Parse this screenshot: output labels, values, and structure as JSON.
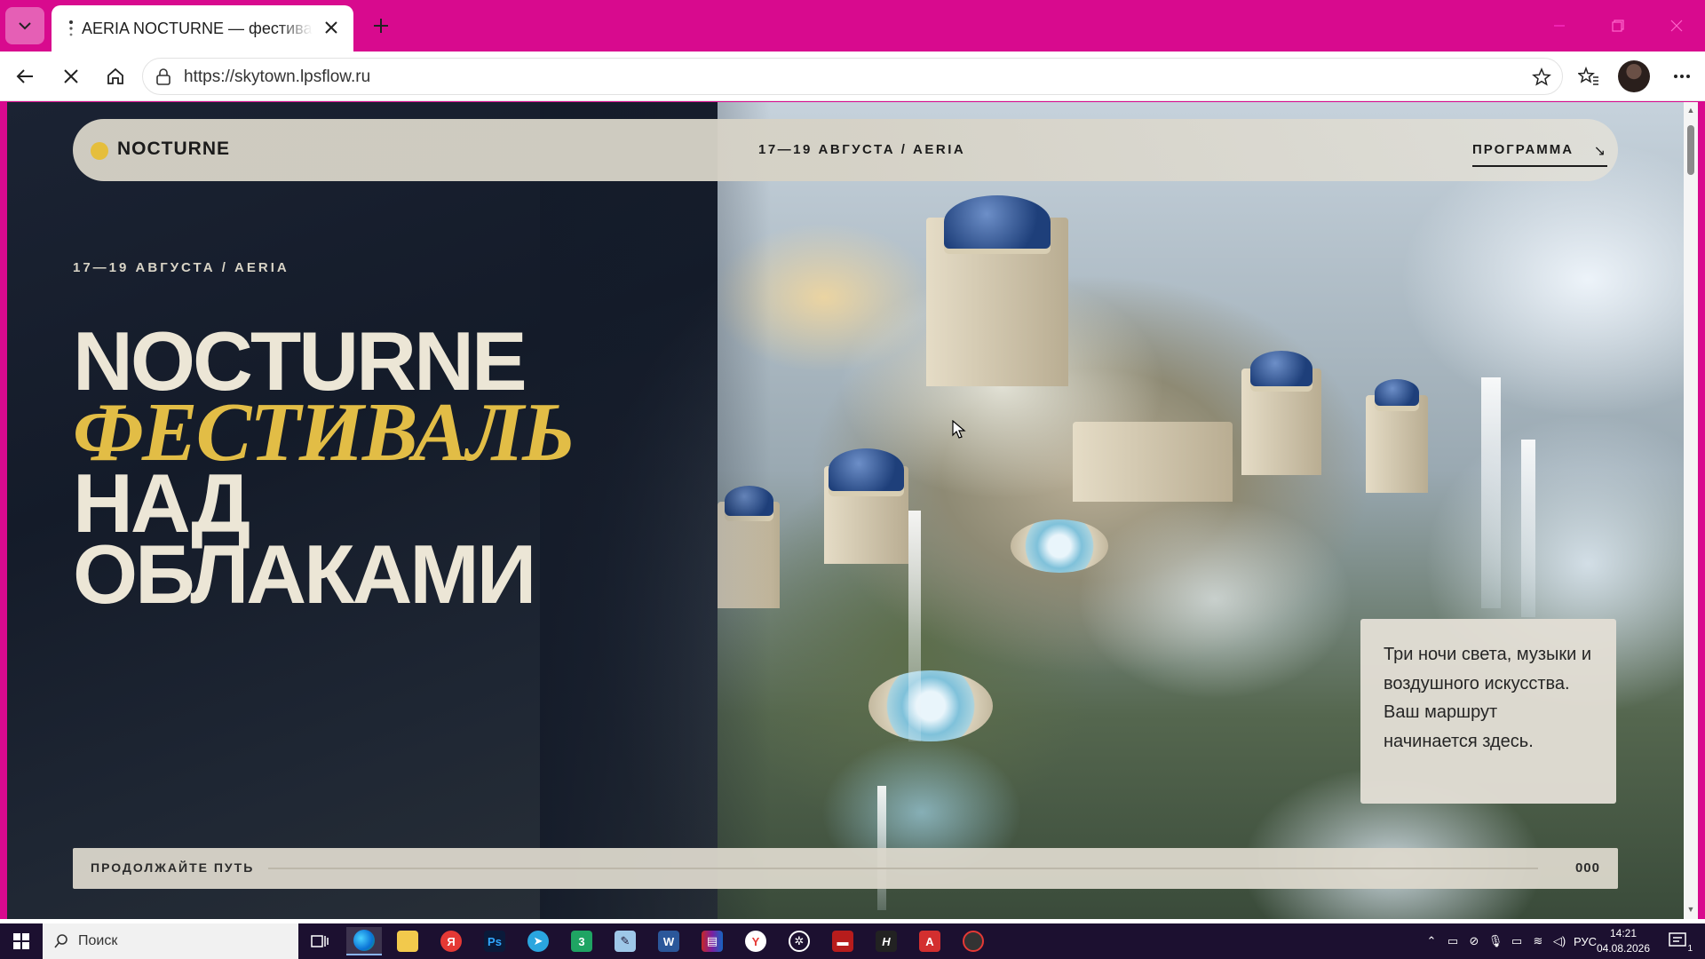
{
  "browser": {
    "tab_title": "AERIA NOCTURNE — фестиваль над облаками",
    "url": "https://skytown.lpsflow.ru"
  },
  "site": {
    "brand": "NOCTURNE",
    "header_date": "17—19 АВГУСТА / AERIA",
    "header_program": "ПРОГРАММА",
    "header_program_arrow": "↘",
    "hero_date": "17—19 АВГУСТА / AERIA",
    "hero_title": {
      "line1": "NOCTURNE",
      "line2": "ФЕСТИВАЛЬ",
      "line3": "НАД",
      "line4": "ОБЛАКАМИ"
    },
    "info_text": "Три ночи света, музыки и воздушного искусства. Ваш маршрут начинается здесь.",
    "progress_label": "ПРОДОЛЖАЙТЕ ПУТЬ",
    "progress_count": "000",
    "progress_value": 0
  },
  "taskbar": {
    "search_placeholder": "Поиск",
    "apps": [
      "edge",
      "explorer",
      "yandex",
      "photoshop",
      "telegram",
      "calculator",
      "notes",
      "word",
      "winrar",
      "yandex-browser",
      "chatgpt",
      "app-red",
      "app-h",
      "acrobat",
      "app-circle"
    ],
    "tray_lang": "РУС",
    "time": "14:21",
    "date": "04.08.2026",
    "notification_count": "1"
  },
  "colors": {
    "chrome": "#d80a8e",
    "accent_gold": "#e2bd46",
    "hero_text": "#ece6d6"
  }
}
